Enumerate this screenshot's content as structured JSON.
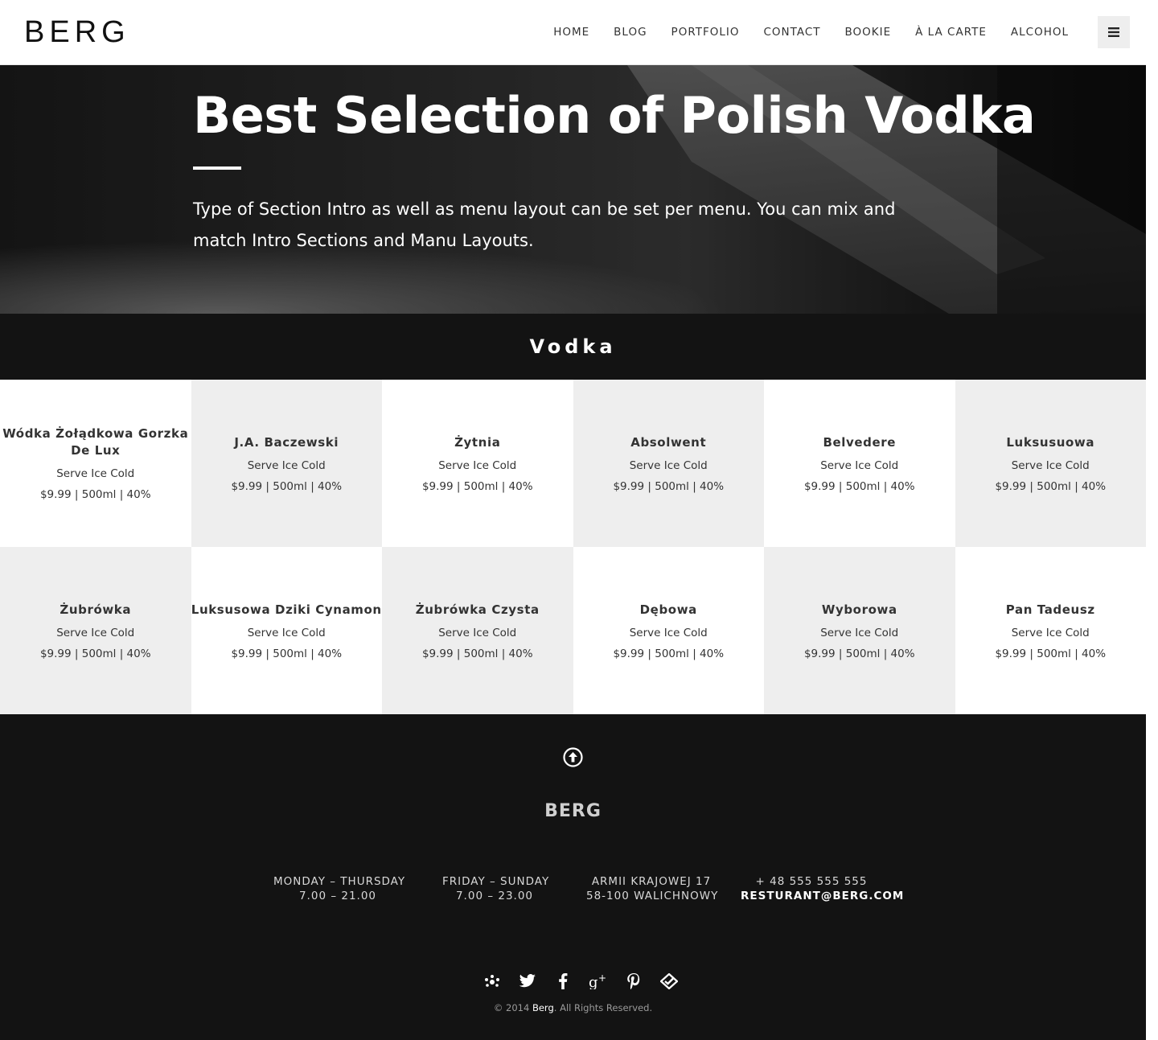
{
  "header": {
    "logo": "BERG",
    "nav": [
      "HOME",
      "BLOG",
      "PORTFOLIO",
      "CONTACT",
      "BOOKIE",
      "À LA CARTE",
      "ALCOHOL"
    ],
    "menu_icon": "hamburger-icon"
  },
  "hero": {
    "title": "Best Selection of Polish Vodka",
    "text": "Type of Section Intro as well as menu layout can be set per menu. You can mix and match Intro Sections and Manu Layouts."
  },
  "section": {
    "title": "Vodka"
  },
  "menu": {
    "items": [
      {
        "name": "Wódka Żołądkowa Gorzka De Lux",
        "desc": "Serve Ice Cold",
        "price": "$9.99 | 500ml | 40%"
      },
      {
        "name": "J.A. Baczewski",
        "desc": "Serve Ice Cold",
        "price": "$9.99 | 500ml | 40%"
      },
      {
        "name": "Żytnia",
        "desc": "Serve Ice Cold",
        "price": "$9.99 | 500ml | 40%"
      },
      {
        "name": "Absolwent",
        "desc": "Serve Ice Cold",
        "price": "$9.99 | 500ml | 40%"
      },
      {
        "name": "Belvedere",
        "desc": "Serve Ice Cold",
        "price": "$9.99 | 500ml | 40%"
      },
      {
        "name": "Luksusuowa",
        "desc": "Serve Ice Cold",
        "price": "$9.99 | 500ml | 40%"
      },
      {
        "name": "Żubrówka",
        "desc": "Serve Ice Cold",
        "price": "$9.99 | 500ml | 40%"
      },
      {
        "name": "Luksusowa Dziki Cynamon",
        "desc": "Serve Ice Cold",
        "price": "$9.99 | 500ml | 40%"
      },
      {
        "name": "Żubrówka Czysta",
        "desc": "Serve Ice Cold",
        "price": "$9.99 | 500ml | 40%"
      },
      {
        "name": "Dębowa",
        "desc": "Serve Ice Cold",
        "price": "$9.99 | 500ml | 40%"
      },
      {
        "name": "Wyborowa",
        "desc": "Serve Ice Cold",
        "price": "$9.99 | 500ml | 40%"
      },
      {
        "name": "Pan Tadeusz",
        "desc": "Serve Ice Cold",
        "price": "$9.99 | 500ml | 40%"
      }
    ]
  },
  "footer": {
    "to_top_icon": "arrow-up-circle-icon",
    "brand": "BERG",
    "hours_weekday": {
      "days": "MONDAY – THURSDAY",
      "time": "7.00 – 21.00"
    },
    "hours_weekend": {
      "days": "FRIDAY – SUNDAY",
      "time": "7.00 – 23.00"
    },
    "address": {
      "line1": "ARMII KRAJOWEJ 17",
      "line2": "58-100 WALICHNOWY"
    },
    "contact": {
      "phone": "+ 48 555 555 555",
      "email": "RESTURANT@BERG.COM"
    },
    "social_icons": [
      "yelp-icon",
      "twitter-icon",
      "facebook-icon",
      "google-plus-icon",
      "pinterest-icon",
      "foursquare-icon"
    ],
    "copyright_prefix": "© 2014",
    "copyright_brand": "Berg",
    "copyright_suffix": ". All Rights Reserved."
  }
}
